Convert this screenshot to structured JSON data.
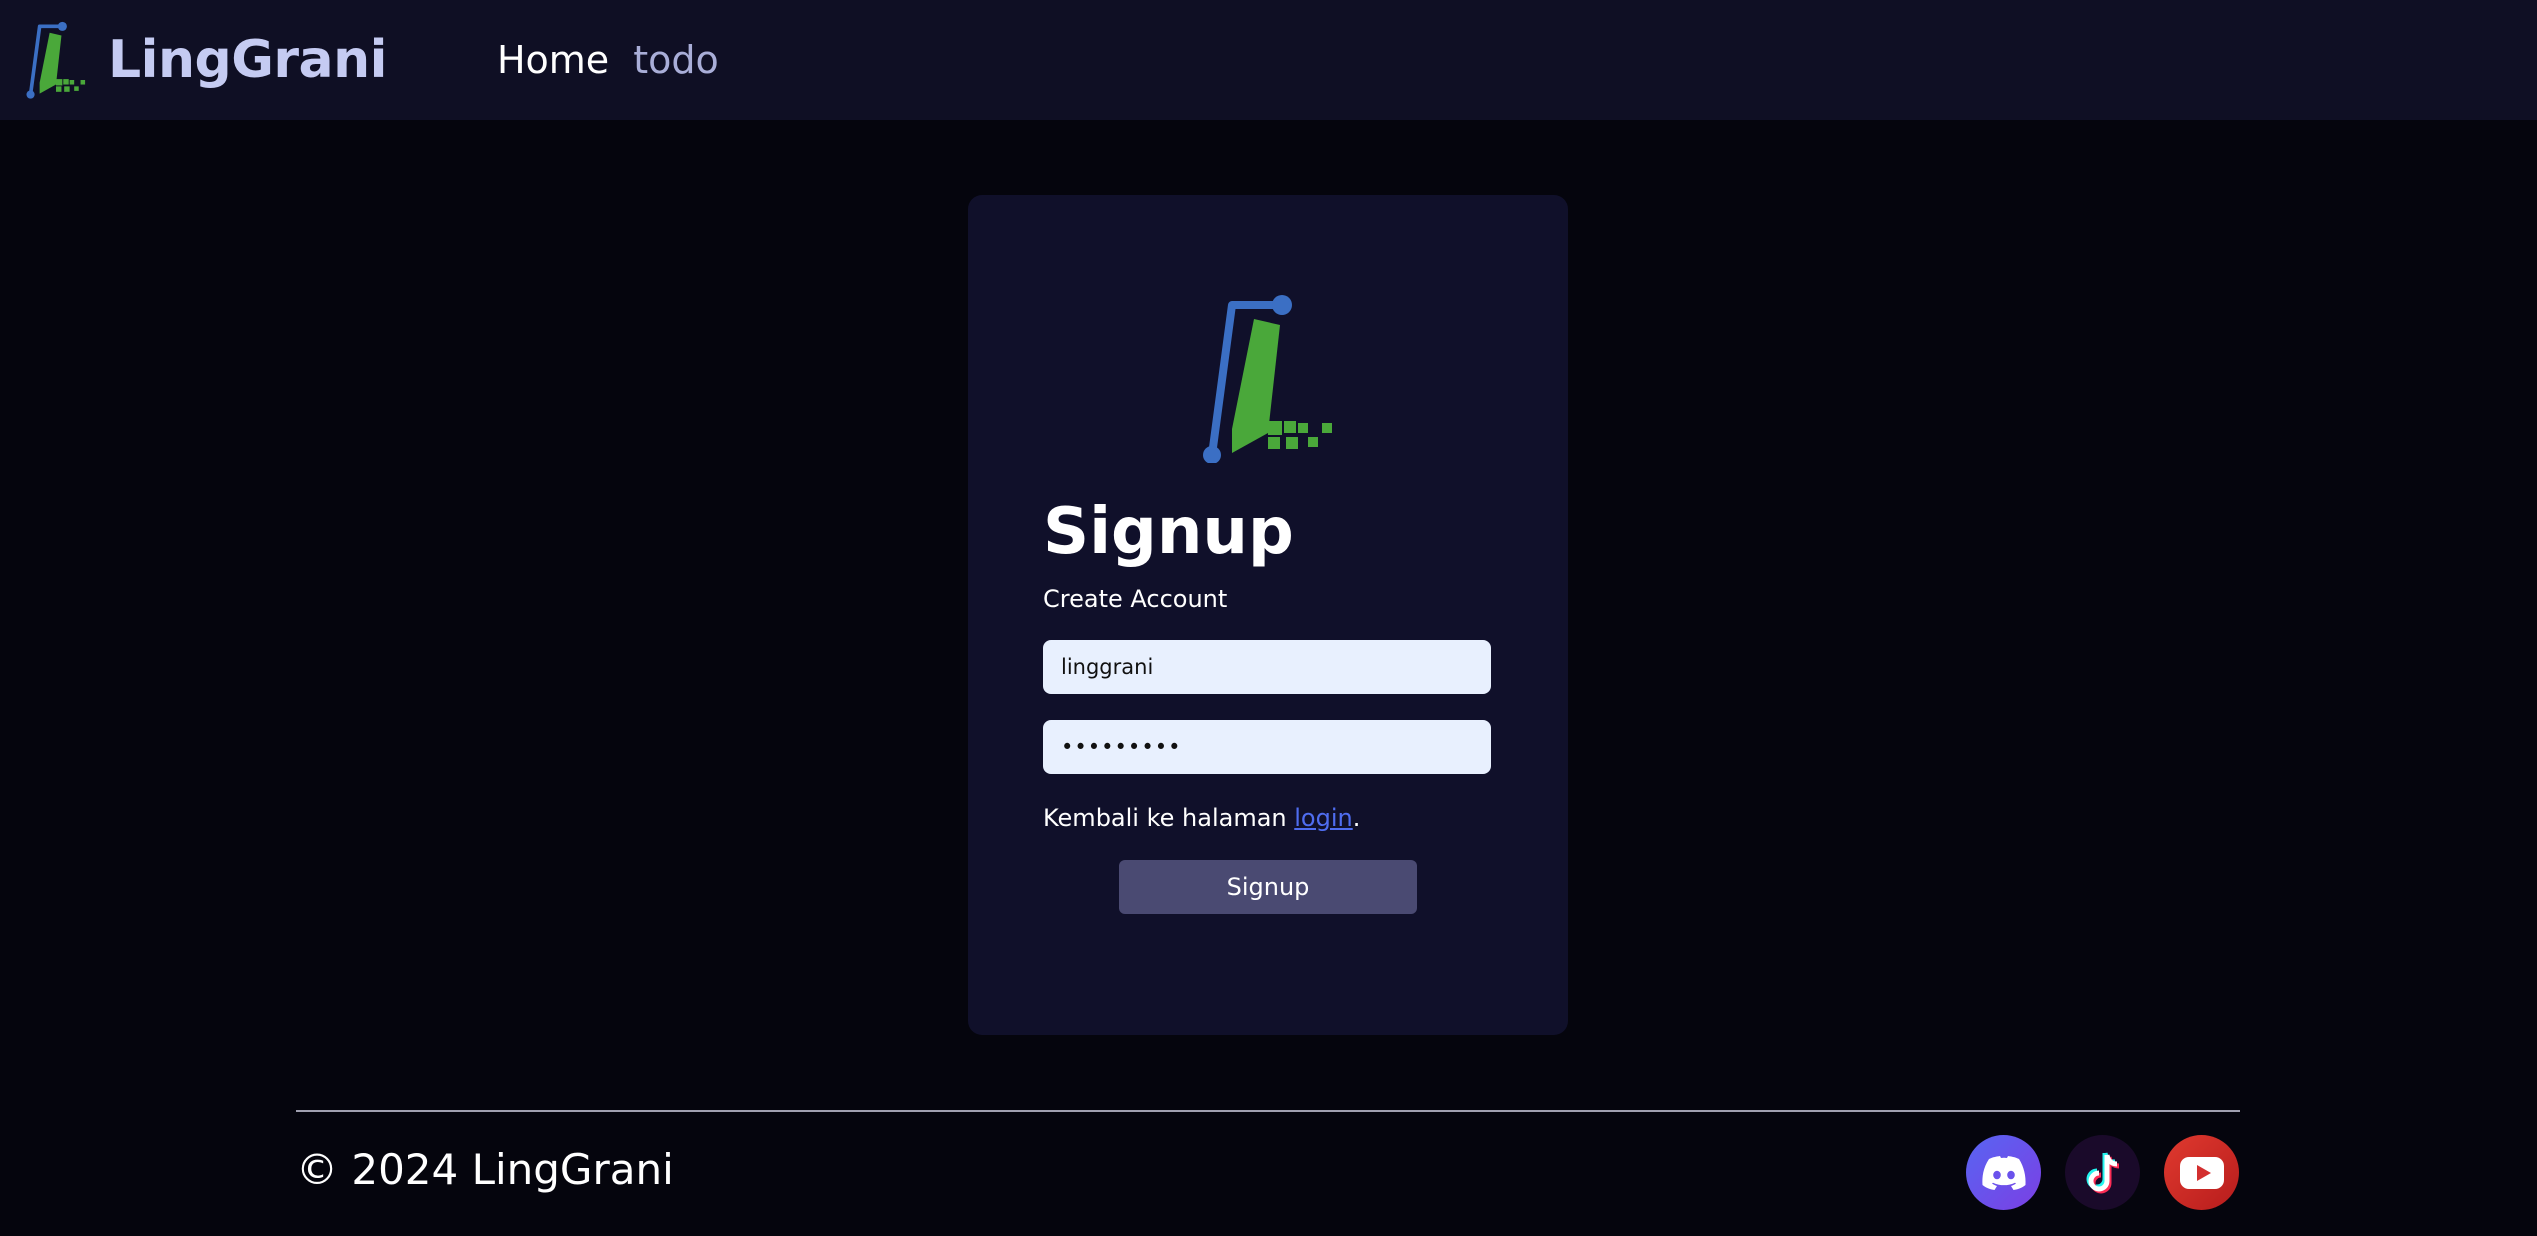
{
  "navbar": {
    "brand": "LingGrani",
    "links": [
      {
        "label": "Home"
      },
      {
        "label": "todo"
      }
    ]
  },
  "signup": {
    "title": "Signup",
    "subtitle": "Create Account",
    "username_value": "linggrani",
    "password_value": "•••••••••",
    "back_prefix": "Kembali ke halaman ",
    "back_link": "login",
    "back_suffix": ".",
    "button_label": "Signup"
  },
  "footer": {
    "copyright": "© 2024 LingGrani",
    "socials": [
      {
        "icon": "discord-icon"
      },
      {
        "icon": "tiktok-icon"
      },
      {
        "icon": "youtube-icon"
      }
    ]
  },
  "colors": {
    "page_bg": "#05050d",
    "navbar_bg": "#0f0f24",
    "card_bg": "#10102a",
    "brand_text": "#c5cbf2",
    "logo_blue": "#3b6fc4",
    "logo_green": "#4aa83a",
    "link": "#4f6df0",
    "button_bg": "#4a4a72"
  }
}
